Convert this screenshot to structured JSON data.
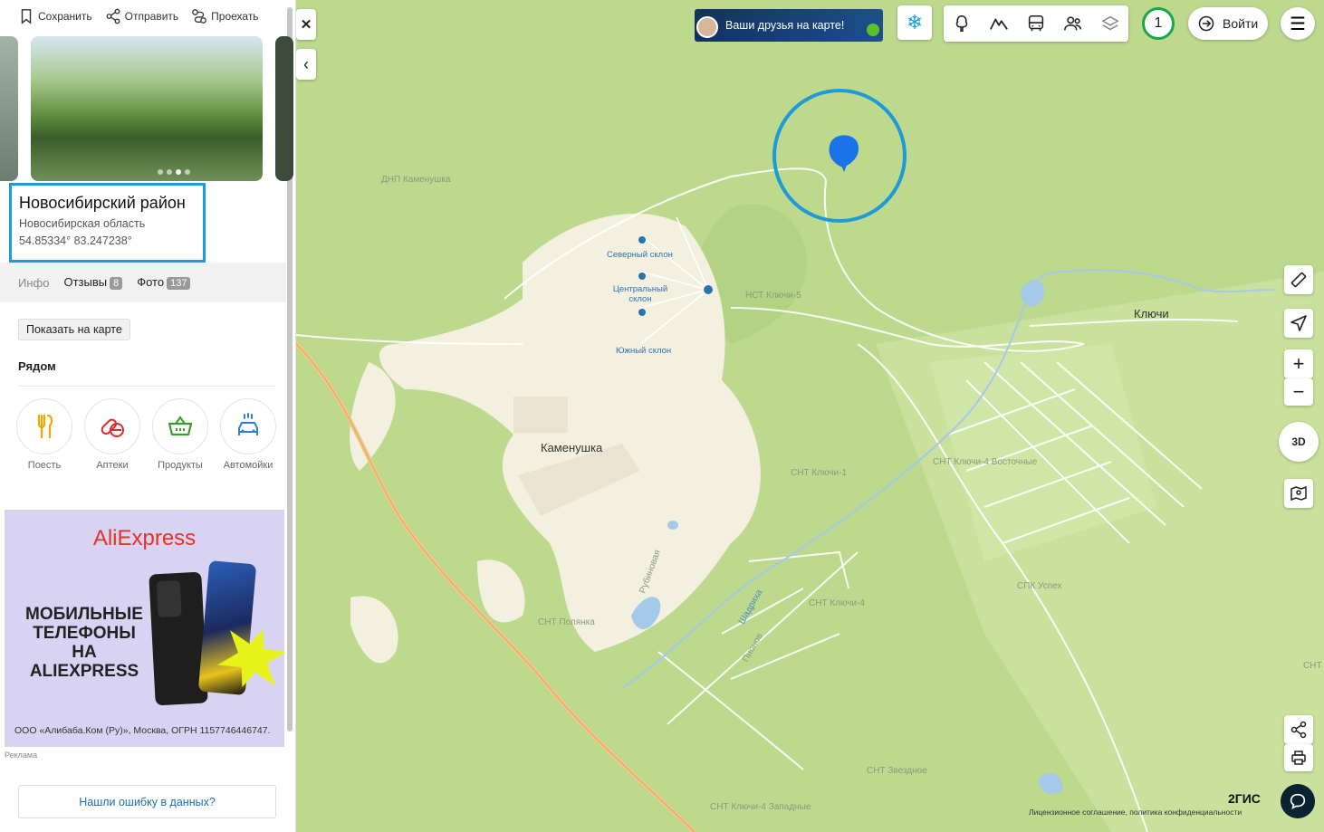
{
  "sidebar": {
    "actions": {
      "save": "Сохранить",
      "send": "Отправить",
      "route": "Проехать"
    },
    "place": {
      "title": "Новосибирский район",
      "region": "Новосибирская область",
      "coords": "54.85334° 83.247238°"
    },
    "tabs": [
      {
        "label": "Инфо"
      },
      {
        "label": "Отзывы",
        "count": "8"
      },
      {
        "label": "Фото",
        "count": "137"
      }
    ],
    "show_on_map": "Показать на карте",
    "nearby": {
      "title": "Рядом",
      "items": [
        {
          "label": "Поесть",
          "icon": "food-icon",
          "color": "#f0a800"
        },
        {
          "label": "Аптеки",
          "icon": "pharmacy-icon",
          "color": "#d62c2c"
        },
        {
          "label": "Продукты",
          "icon": "basket-icon",
          "color": "#3b9a2a"
        },
        {
          "label": "Автомойки",
          "icon": "car-wash-icon",
          "color": "#2f7fd1"
        }
      ]
    },
    "ad": {
      "brand": "AliExpress",
      "headline": "МОБИЛЬНЫЕ ТЕЛЕФОНЫ НА ALIEXPRESS",
      "legal": "ООО «Алибаба.Ком (Ру)», Москва, ОГРН 1157746446747.",
      "mark": "Реклама"
    },
    "report_error": "Нашли ошибку в данных?"
  },
  "map": {
    "friends_banner": "Ваши друзья на карте!",
    "login": "Войти",
    "counter": "1",
    "brand": "2ГИС",
    "license": "Лицензионное соглашение, политика конфиденциальности",
    "labels": {
      "dnp": "ДНП Каменушка",
      "north_slope": "Северный склон",
      "central_slope": "Центральный склон",
      "south_slope": "Южный склон",
      "nst": "НСТ Ключи-5",
      "klyuchi": "Ключи",
      "kamenushka": "Каменушка",
      "snt_k1": "СНТ Ключи-1",
      "snt_k4v": "СНТ Ключи-4 Восточные",
      "snt_k4": "СНТ Ключи-4",
      "spk": "СПК Успех",
      "snt_polyanka": "СНТ Полянка",
      "rubinovaya": "Рубиновая",
      "pionov": "Пионов",
      "shadriha": "Шадриха",
      "snt_zvezdnoe": "СНТ Звездное",
      "snt_k4z": "СНТ Ключи-4 Западные",
      "snt_be": "СНТ Бе"
    },
    "controls": {
      "three_d": "3D"
    },
    "colors": {
      "marker": "#1a73e8",
      "highlight_ring": "#1e9ad6",
      "forest": "#bcd98e",
      "settlement": "#f4f0df"
    }
  }
}
